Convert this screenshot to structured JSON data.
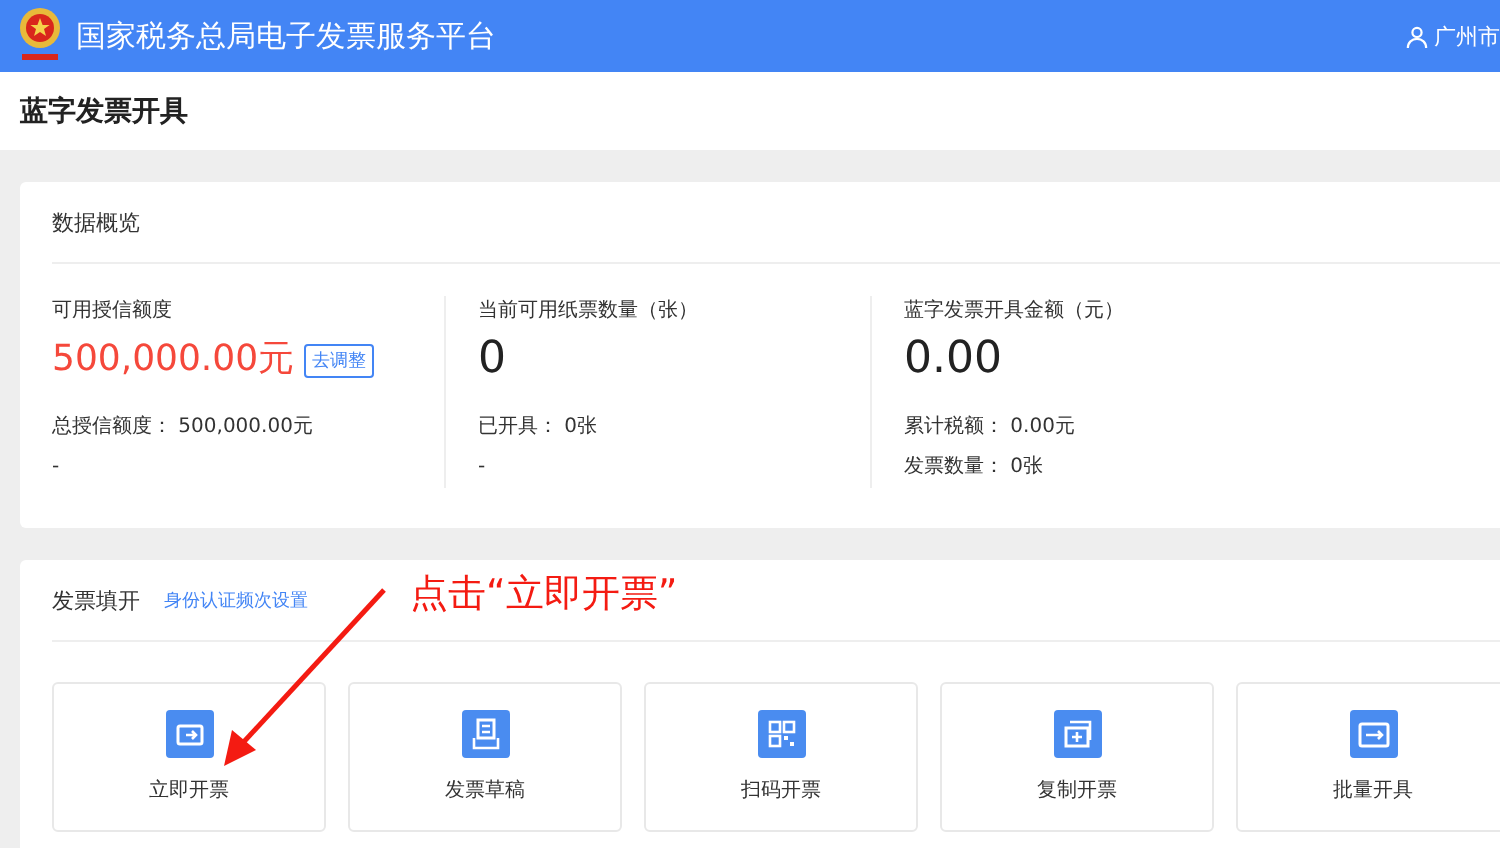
{
  "header": {
    "title": "国家税务总局电子发票服务平台",
    "user": "广州市"
  },
  "page_title": "蓝字发票开具",
  "overview": {
    "title": "数据概览",
    "columns": [
      {
        "label": "可用授信额度",
        "value": "500,000.00元",
        "highlight": true,
        "action": "去调整",
        "details": [
          "总授信额度： 500,000.00元",
          "-"
        ]
      },
      {
        "label": "当前可用纸票数量（张）",
        "value": "0",
        "highlight": false,
        "details": [
          "已开具： 0张",
          "-"
        ]
      },
      {
        "label": "蓝字发票开具金额（元）",
        "value": "0.00",
        "highlight": false,
        "details": [
          "累计税额： 0.00元",
          "发票数量： 0张"
        ]
      }
    ]
  },
  "fill": {
    "title": "发票填开",
    "link": "身份认证频次设置",
    "annotation": "点击“立即开票”",
    "tiles": [
      {
        "label": "立即开票",
        "kind": "ticket-arrow"
      },
      {
        "label": "发票草稿",
        "kind": "draft"
      },
      {
        "label": "扫码开票",
        "kind": "qr"
      },
      {
        "label": "复制开票",
        "kind": "copy"
      },
      {
        "label": "批量开具",
        "kind": "batch"
      }
    ]
  }
}
